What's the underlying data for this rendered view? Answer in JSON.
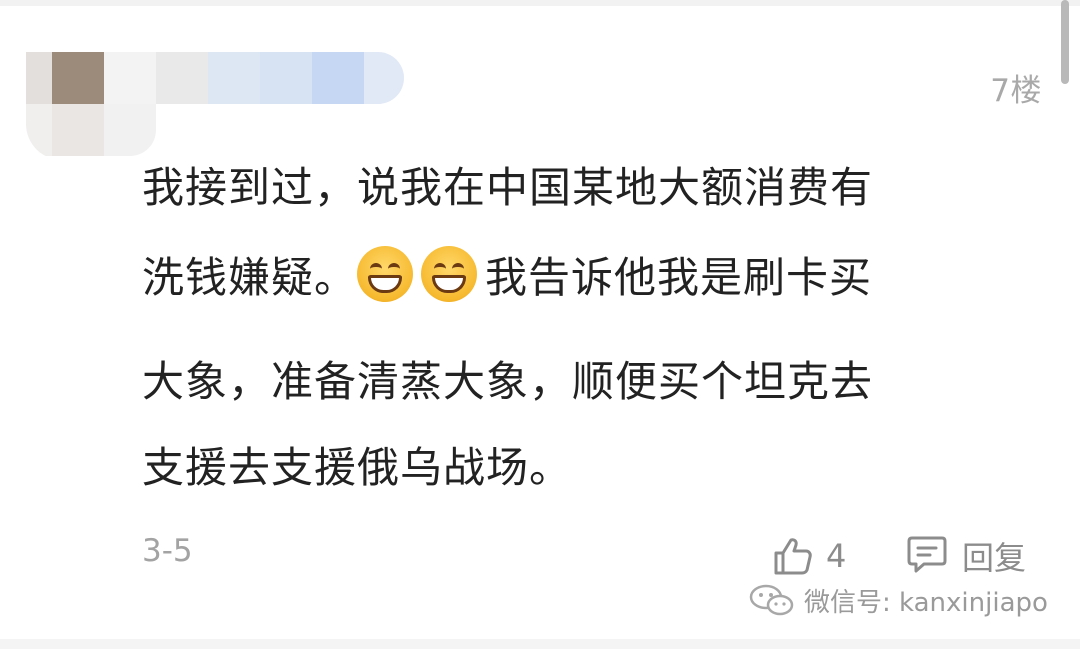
{
  "comment": {
    "floor": "7楼",
    "lines": [
      "我接到过，说我在中国某地大额消费有",
      "洗钱嫌疑。",
      "我告诉他我是刷卡买",
      "大象，准备清蒸大象，顺便买个坦克去",
      "支援去支援俄乌战场。"
    ],
    "date": "3-5",
    "like_count": "4",
    "reply_label": "回复"
  },
  "icons": {
    "emoji": "grinning-face-emoji",
    "like": "thumbs-up-icon",
    "reply": "comment-bubble-icon",
    "watermark": "wechat-icon"
  },
  "watermark": {
    "text": "微信号: kanxinjiapo"
  },
  "colors": {
    "text": "#222222",
    "meta": "#a3a3a3",
    "action": "#8c8c8c"
  }
}
